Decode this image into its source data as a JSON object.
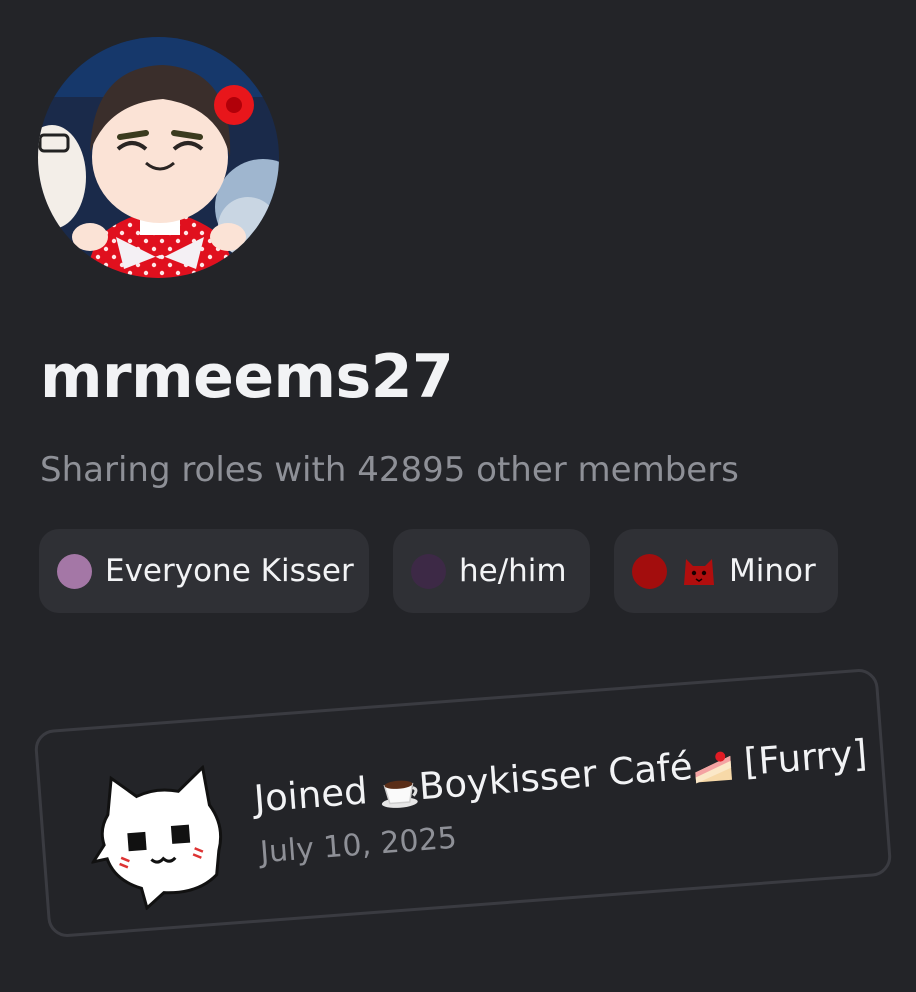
{
  "profile": {
    "username": "mrmeems27",
    "shared_roles_text": "Sharing roles with 42895 other members",
    "avatar": {
      "icon": "doll-plush-avatar"
    }
  },
  "roles": [
    {
      "label": "Everyone Kisser",
      "color": "#a477a6"
    },
    {
      "label": "he/him",
      "color": "#3d2946"
    },
    {
      "label": "Minor",
      "color": "#a30d0d",
      "icon": "red-cat-icon"
    }
  ],
  "join": {
    "prefix": "Joined",
    "server_name": "Boykisser Café",
    "suffix": "[Furry]",
    "date": "July 10, 2025",
    "icons": [
      "coffee-cup-icon",
      "cake-slice-icon"
    ],
    "server_icon": "white-cat-icon"
  },
  "colors": {
    "background": "#232428",
    "chip_background": "#2f3035",
    "muted_text": "#8e9097",
    "primary_text": "#f2f3f5"
  }
}
